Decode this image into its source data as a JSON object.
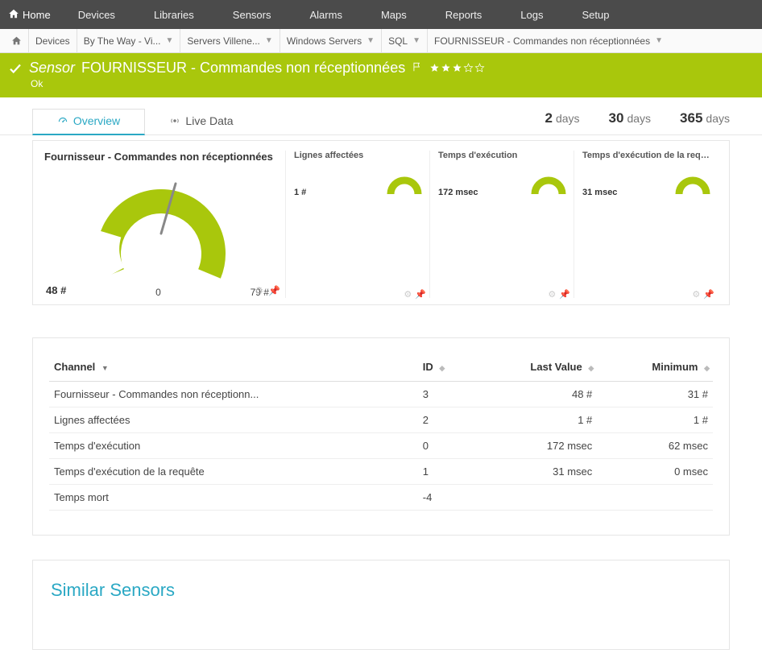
{
  "topnav": {
    "home": "Home",
    "items": [
      "Devices",
      "Libraries",
      "Sensors",
      "Alarms",
      "Maps",
      "Reports",
      "Logs",
      "Setup"
    ]
  },
  "breadcrumb": {
    "items": [
      {
        "label": "Devices",
        "dropdown": false
      },
      {
        "label": "By The Way - Vi...",
        "dropdown": true
      },
      {
        "label": "Servers Villene...",
        "dropdown": true
      },
      {
        "label": "Windows Servers",
        "dropdown": true
      },
      {
        "label": "SQL",
        "dropdown": true
      },
      {
        "label": "FOURNISSEUR - Commandes non réceptionnées",
        "dropdown": true
      }
    ]
  },
  "sensor": {
    "prefix": "Sensor",
    "name": "FOURNISSEUR - Commandes non réceptionnées",
    "status": "Ok",
    "stars_filled": 3,
    "stars_total": 5
  },
  "tabs": {
    "overview": "Overview",
    "live": "Live Data",
    "ranges": [
      {
        "num": "2",
        "unit": "days"
      },
      {
        "num": "30",
        "unit": "days"
      },
      {
        "num": "365",
        "unit": "days"
      }
    ]
  },
  "chart_data": [
    {
      "type": "gauge",
      "title": "Fournisseur - Commandes non réceptionnées",
      "value": 48,
      "unit": "#",
      "min": 0,
      "max": 79,
      "value_label": "48 #",
      "min_label": "0",
      "max_label": "79 #"
    },
    {
      "type": "gauge",
      "title": "Lignes affectées",
      "value": 1,
      "unit": "#",
      "value_label": "1 #"
    },
    {
      "type": "gauge",
      "title": "Temps d'exécution",
      "value": 172,
      "unit": "msec",
      "value_label": "172 msec"
    },
    {
      "type": "gauge",
      "title": "Temps d'exécution de la requ...",
      "value": 31,
      "unit": "msec",
      "value_label": "31 msec"
    }
  ],
  "table": {
    "headers": {
      "channel": "Channel",
      "id": "ID",
      "last": "Last Value",
      "min": "Minimum"
    },
    "rows": [
      {
        "channel": "Fournisseur - Commandes non réceptionn...",
        "id": "3",
        "last": "48 #",
        "min": "31 #"
      },
      {
        "channel": "Lignes affectées",
        "id": "2",
        "last": "1 #",
        "min": "1 #"
      },
      {
        "channel": "Temps d'exécution",
        "id": "0",
        "last": "172 msec",
        "min": "62 msec"
      },
      {
        "channel": "Temps d'exécution de la requête",
        "id": "1",
        "last": "31 msec",
        "min": "0 msec"
      },
      {
        "channel": "Temps mort",
        "id": "-4",
        "last": "",
        "min": ""
      }
    ]
  },
  "similar": {
    "title": "Similar Sensors"
  },
  "colors": {
    "accent": "#a9c70c",
    "link": "#2aa8c4"
  }
}
